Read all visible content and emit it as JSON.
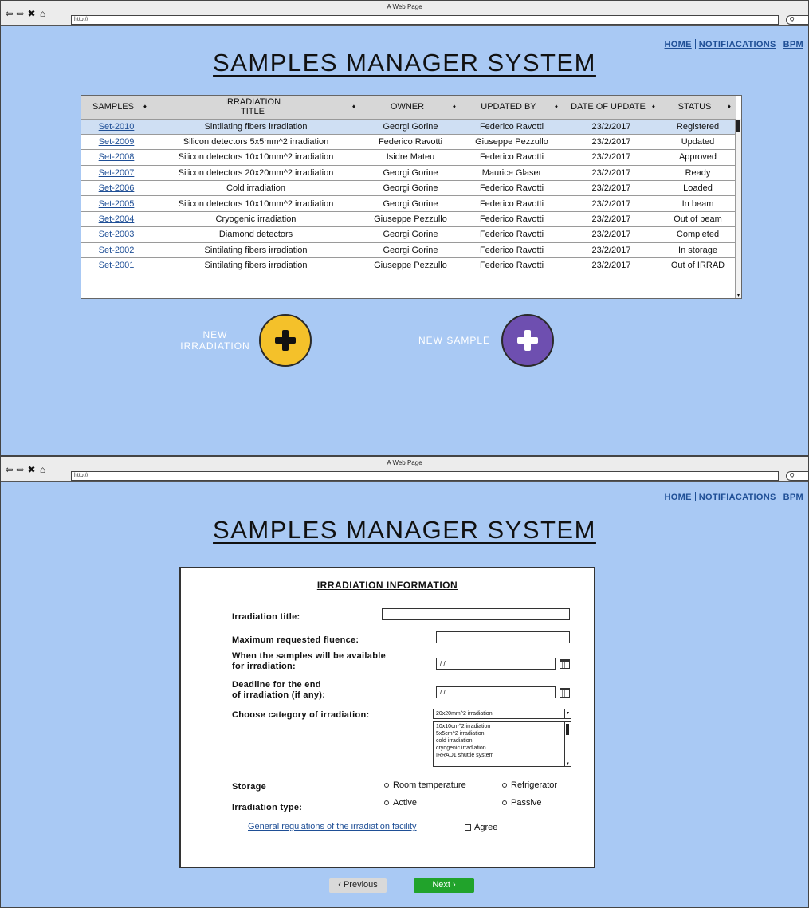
{
  "browser": {
    "title": "A Web Page",
    "url": "http://",
    "search_placeholder": "Q"
  },
  "top_links": {
    "home": "HOME",
    "notifications": "NOTIFIACATIONS",
    "bpm": "BPM"
  },
  "app_title": "SAMPLES MANAGER SYSTEM",
  "table": {
    "columns": [
      "SAMPLES",
      "IRRADIATION TITLE",
      "OWNER",
      "UPDATED BY",
      "DATE OF UPDATE",
      "STATUS"
    ],
    "rows": [
      {
        "sample": "Set-2010",
        "title": "Sintilating fibers irradiation",
        "owner": "Georgi Gorine",
        "updated_by": "Federico Ravotti",
        "date": "23/2/2017",
        "status": "Registered"
      },
      {
        "sample": "Set-2009",
        "title": "Silicon detectors 5x5mm^2 irradiation",
        "owner": "Federico Ravotti",
        "updated_by": "Giuseppe Pezzullo",
        "date": "23/2/2017",
        "status": "Updated"
      },
      {
        "sample": "Set-2008",
        "title": "Silicon detectors 10x10mm^2 irradiation",
        "owner": "Isidre Mateu",
        "updated_by": "Federico Ravotti",
        "date": "23/2/2017",
        "status": "Approved"
      },
      {
        "sample": "Set-2007",
        "title": "Silicon detectors 20x20mm^2 irradiation",
        "owner": "Georgi Gorine",
        "updated_by": "Maurice Glaser",
        "date": "23/2/2017",
        "status": "Ready"
      },
      {
        "sample": "Set-2006",
        "title": "Cold irradiation",
        "owner": "Georgi Gorine",
        "updated_by": "Federico Ravotti",
        "date": "23/2/2017",
        "status": "Loaded"
      },
      {
        "sample": "Set-2005",
        "title": "Silicon detectors 10x10mm^2 irradiation",
        "owner": "Georgi Gorine",
        "updated_by": "Federico Ravotti",
        "date": "23/2/2017",
        "status": "In beam"
      },
      {
        "sample": "Set-2004",
        "title": "Cryogenic irradiation",
        "owner": "Giuseppe Pezzullo",
        "updated_by": "Federico Ravotti",
        "date": "23/2/2017",
        "status": "Out of beam"
      },
      {
        "sample": "Set-2003",
        "title": "Diamond detectors",
        "owner": "Georgi Gorine",
        "updated_by": "Federico Ravotti",
        "date": "23/2/2017",
        "status": "Completed"
      },
      {
        "sample": "Set-2002",
        "title": "Sintilating fibers irradiation",
        "owner": "Georgi Gorine",
        "updated_by": "Federico Ravotti",
        "date": "23/2/2017",
        "status": "In storage"
      },
      {
        "sample": "Set-2001",
        "title": "Sintilating fibers irradiation",
        "owner": "Giuseppe Pezzullo",
        "updated_by": "Federico Ravotti",
        "date": "23/2/2017",
        "status": "Out of IRRAD"
      }
    ]
  },
  "actions": {
    "new_irradiation": "NEW IRRADIATION",
    "new_sample": "NEW SAMPLE",
    "irradiation_color": "#f4c12a",
    "sample_color": "#6e4fb0"
  },
  "form": {
    "heading": "IRRADIATION INFORMATION",
    "irradiation_title_label": "Irradiation title:",
    "fluence_label": "Maximum requested fluence:",
    "available_label_1": "When the samples will be available",
    "available_label_2": "for irradiation:",
    "available_value": "/ /",
    "deadline_label_1": "Deadline for the end",
    "deadline_label_2": "of irradiation (if any):",
    "deadline_value": "/ /",
    "category_label": "Choose category of irradiation:",
    "category_selected": "20x20mm^2 irradiation",
    "category_options": [
      "10x10cm^2 irradiation",
      "5x5cm^2 irradiation",
      "cold irradiation",
      "cryogenic irradiation",
      "IRRAD1 shuttle system"
    ],
    "storage_label": "Storage",
    "storage_options": [
      "Room temperature",
      "Refrigerator"
    ],
    "type_label": "Irradiation type:",
    "type_options": [
      "Active",
      "Passive"
    ],
    "regulations_link": "General regulations of the irradiation facility",
    "agree_label": "Agree"
  },
  "buttons": {
    "previous": "‹ Previous",
    "next": "Next   ›"
  }
}
